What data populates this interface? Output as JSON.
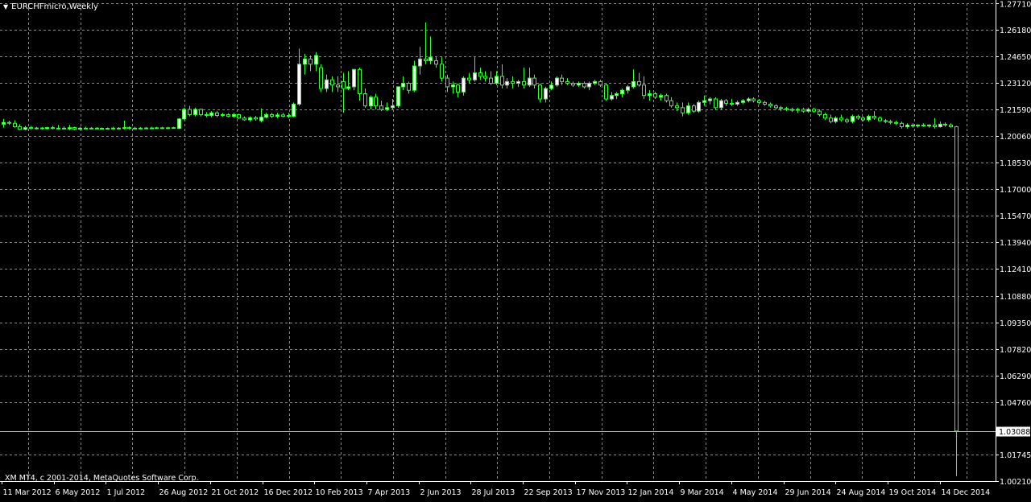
{
  "title": "EURCHFmicro,Weekly",
  "copyright": "XM MT4, c 2001-2014, MetaQuotes Software Corp.",
  "colors": {
    "background": "#000000",
    "bull": "#ffffff",
    "bear": "#000000",
    "wick": "#33ff33",
    "grid": "#8a8a8a",
    "axis_text": "#ffffff"
  },
  "icons": {
    "title_menu": "triangle-down-icon"
  },
  "chart_data": {
    "type": "candlestick",
    "symbol": "EURCHFmicro",
    "timeframe": "Weekly",
    "ylim": [
      1.0021,
      1.2771
    ],
    "grid": true,
    "y_ticks": [
      "1.27710",
      "1.26180",
      "1.24650",
      "1.23120",
      "1.21590",
      "1.20060",
      "1.18530",
      "1.17000",
      "1.15470",
      "1.13940",
      "1.12410",
      "1.10880",
      "1.09350",
      "1.07820",
      "1.06290",
      "1.04760",
      "1.03088",
      "1.01745",
      "1.00210"
    ],
    "current_price": "1.03088",
    "x_tick_labels": [
      "11 Mar 2012",
      "6 May 2012",
      "1 Jul 2012",
      "26 Aug 2012",
      "21 Oct 2012",
      "16 Dec 2012",
      "10 Feb 2013",
      "7 Apr 2013",
      "2 Jun 2013",
      "28 Jul 2013",
      "22 Sep 2013",
      "17 Nov 2013",
      "12 Jan 2014",
      "9 Mar 2014",
      "4 May 2014",
      "29 Jun 2014",
      "24 Aug 2014",
      "19 Oct 2014",
      "14 Dec 2014"
    ],
    "candles": [
      {
        "o": 1.2075,
        "h": 1.2105,
        "l": 1.2055,
        "c": 1.2085
      },
      {
        "o": 1.2085,
        "h": 1.2095,
        "l": 1.207,
        "c": 1.208
      },
      {
        "o": 1.208,
        "h": 1.2098,
        "l": 1.2055,
        "c": 1.206
      },
      {
        "o": 1.206,
        "h": 1.2075,
        "l": 1.204,
        "c": 1.2045
      },
      {
        "o": 1.2045,
        "h": 1.2065,
        "l": 1.204,
        "c": 1.2055
      },
      {
        "o": 1.2055,
        "h": 1.2065,
        "l": 1.2045,
        "c": 1.205
      },
      {
        "o": 1.205,
        "h": 1.206,
        "l": 1.2045,
        "c": 1.2053
      },
      {
        "o": 1.2053,
        "h": 1.2058,
        "l": 1.2045,
        "c": 1.2049
      },
      {
        "o": 1.2049,
        "h": 1.206,
        "l": 1.2045,
        "c": 1.2055
      },
      {
        "o": 1.2055,
        "h": 1.2065,
        "l": 1.2045,
        "c": 1.205
      },
      {
        "o": 1.205,
        "h": 1.207,
        "l": 1.2045,
        "c": 1.2052
      },
      {
        "o": 1.2052,
        "h": 1.2062,
        "l": 1.2045,
        "c": 1.2048
      },
      {
        "o": 1.2048,
        "h": 1.207,
        "l": 1.204,
        "c": 1.2055
      },
      {
        "o": 1.2055,
        "h": 1.206,
        "l": 1.204,
        "c": 1.2046
      },
      {
        "o": 1.2046,
        "h": 1.206,
        "l": 1.2043,
        "c": 1.2052
      },
      {
        "o": 1.2052,
        "h": 1.206,
        "l": 1.2047,
        "c": 1.205
      },
      {
        "o": 1.205,
        "h": 1.2058,
        "l": 1.2046,
        "c": 1.2052
      },
      {
        "o": 1.2052,
        "h": 1.2058,
        "l": 1.2047,
        "c": 1.205
      },
      {
        "o": 1.205,
        "h": 1.2056,
        "l": 1.2046,
        "c": 1.2051
      },
      {
        "o": 1.2051,
        "h": 1.2056,
        "l": 1.2047,
        "c": 1.205
      },
      {
        "o": 1.205,
        "h": 1.206,
        "l": 1.2046,
        "c": 1.2052
      },
      {
        "o": 1.2052,
        "h": 1.2058,
        "l": 1.2047,
        "c": 1.205
      },
      {
        "o": 1.205,
        "h": 1.2095,
        "l": 1.2045,
        "c": 1.2055
      },
      {
        "o": 1.2055,
        "h": 1.2062,
        "l": 1.2045,
        "c": 1.205
      },
      {
        "o": 1.205,
        "h": 1.206,
        "l": 1.2048,
        "c": 1.2052
      },
      {
        "o": 1.2052,
        "h": 1.2058,
        "l": 1.2048,
        "c": 1.205
      },
      {
        "o": 1.205,
        "h": 1.2058,
        "l": 1.2048,
        "c": 1.2053
      },
      {
        "o": 1.2053,
        "h": 1.206,
        "l": 1.2048,
        "c": 1.2051
      },
      {
        "o": 1.2051,
        "h": 1.206,
        "l": 1.2048,
        "c": 1.2054
      },
      {
        "o": 1.2054,
        "h": 1.206,
        "l": 1.2047,
        "c": 1.2052
      },
      {
        "o": 1.2052,
        "h": 1.206,
        "l": 1.2048,
        "c": 1.2054
      },
      {
        "o": 1.2054,
        "h": 1.206,
        "l": 1.205,
        "c": 1.2055
      },
      {
        "o": 1.205,
        "h": 1.211,
        "l": 1.2048,
        "c": 1.2105
      },
      {
        "o": 1.2105,
        "h": 1.217,
        "l": 1.21,
        "c": 1.216
      },
      {
        "o": 1.216,
        "h": 1.218,
        "l": 1.212,
        "c": 1.213
      },
      {
        "o": 1.213,
        "h": 1.217,
        "l": 1.212,
        "c": 1.216
      },
      {
        "o": 1.216,
        "h": 1.2165,
        "l": 1.212,
        "c": 1.213
      },
      {
        "o": 1.213,
        "h": 1.2145,
        "l": 1.2115,
        "c": 1.2125
      },
      {
        "o": 1.2125,
        "h": 1.215,
        "l": 1.2115,
        "c": 1.214
      },
      {
        "o": 1.214,
        "h": 1.215,
        "l": 1.2115,
        "c": 1.2125
      },
      {
        "o": 1.2125,
        "h": 1.214,
        "l": 1.2118,
        "c": 1.213
      },
      {
        "o": 1.213,
        "h": 1.2138,
        "l": 1.2115,
        "c": 1.212
      },
      {
        "o": 1.212,
        "h": 1.214,
        "l": 1.2112,
        "c": 1.213
      },
      {
        "o": 1.213,
        "h": 1.2135,
        "l": 1.2105,
        "c": 1.211
      },
      {
        "o": 1.211,
        "h": 1.212,
        "l": 1.2095,
        "c": 1.21
      },
      {
        "o": 1.21,
        "h": 1.212,
        "l": 1.209,
        "c": 1.2112
      },
      {
        "o": 1.2112,
        "h": 1.2122,
        "l": 1.2095,
        "c": 1.2105
      },
      {
        "o": 1.2095,
        "h": 1.2165,
        "l": 1.2085,
        "c": 1.2115
      },
      {
        "o": 1.2115,
        "h": 1.214,
        "l": 1.2108,
        "c": 1.213
      },
      {
        "o": 1.213,
        "h": 1.214,
        "l": 1.211,
        "c": 1.212
      },
      {
        "o": 1.212,
        "h": 1.214,
        "l": 1.211,
        "c": 1.2128
      },
      {
        "o": 1.2128,
        "h": 1.214,
        "l": 1.2115,
        "c": 1.212
      },
      {
        "o": 1.212,
        "h": 1.214,
        "l": 1.211,
        "c": 1.2125
      },
      {
        "o": 1.212,
        "h": 1.22,
        "l": 1.2115,
        "c": 1.219
      },
      {
        "o": 1.219,
        "h": 1.251,
        "l": 1.218,
        "c": 1.242
      },
      {
        "o": 1.242,
        "h": 1.248,
        "l": 1.236,
        "c": 1.245
      },
      {
        "o": 1.245,
        "h": 1.247,
        "l": 1.238,
        "c": 1.242
      },
      {
        "o": 1.242,
        "h": 1.249,
        "l": 1.238,
        "c": 1.247
      },
      {
        "o": 1.24,
        "h": 1.242,
        "l": 1.226,
        "c": 1.228
      },
      {
        "o": 1.228,
        "h": 1.236,
        "l": 1.226,
        "c": 1.233
      },
      {
        "o": 1.233,
        "h": 1.235,
        "l": 1.226,
        "c": 1.23
      },
      {
        "o": 1.23,
        "h": 1.235,
        "l": 1.226,
        "c": 1.229
      },
      {
        "o": 1.232,
        "h": 1.237,
        "l": 1.214,
        "c": 1.228
      },
      {
        "o": 1.228,
        "h": 1.238,
        "l": 1.227,
        "c": 1.229
      },
      {
        "o": 1.229,
        "h": 1.238,
        "l": 1.227,
        "c": 1.239
      },
      {
        "o": 1.239,
        "h": 1.24,
        "l": 1.221,
        "c": 1.225
      },
      {
        "o": 1.225,
        "h": 1.228,
        "l": 1.217,
        "c": 1.218
      },
      {
        "o": 1.218,
        "h": 1.224,
        "l": 1.216,
        "c": 1.223
      },
      {
        "o": 1.223,
        "h": 1.225,
        "l": 1.216,
        "c": 1.218
      },
      {
        "o": 1.218,
        "h": 1.221,
        "l": 1.215,
        "c": 1.216
      },
      {
        "o": 1.216,
        "h": 1.22,
        "l": 1.215,
        "c": 1.217
      },
      {
        "o": 1.217,
        "h": 1.222,
        "l": 1.216,
        "c": 1.218
      },
      {
        "o": 1.218,
        "h": 1.229,
        "l": 1.217,
        "c": 1.229
      },
      {
        "o": 1.229,
        "h": 1.235,
        "l": 1.227,
        "c": 1.231
      },
      {
        "o": 1.231,
        "h": 1.232,
        "l": 1.225,
        "c": 1.227
      },
      {
        "o": 1.227,
        "h": 1.244,
        "l": 1.226,
        "c": 1.241
      },
      {
        "o": 1.241,
        "h": 1.252,
        "l": 1.236,
        "c": 1.245
      },
      {
        "o": 1.245,
        "h": 1.266,
        "l": 1.242,
        "c": 1.244
      },
      {
        "o": 1.244,
        "h": 1.258,
        "l": 1.242,
        "c": 1.246
      },
      {
        "o": 1.244,
        "h": 1.246,
        "l": 1.24,
        "c": 1.242
      },
      {
        "o": 1.242,
        "h": 1.246,
        "l": 1.232,
        "c": 1.234
      },
      {
        "o": 1.234,
        "h": 1.236,
        "l": 1.226,
        "c": 1.229
      },
      {
        "o": 1.229,
        "h": 1.232,
        "l": 1.225,
        "c": 1.23
      },
      {
        "o": 1.23,
        "h": 1.231,
        "l": 1.223,
        "c": 1.226
      },
      {
        "o": 1.226,
        "h": 1.235,
        "l": 1.224,
        "c": 1.234
      },
      {
        "o": 1.234,
        "h": 1.237,
        "l": 1.231,
        "c": 1.233
      },
      {
        "o": 1.233,
        "h": 1.246,
        "l": 1.232,
        "c": 1.237
      },
      {
        "o": 1.237,
        "h": 1.24,
        "l": 1.233,
        "c": 1.235
      },
      {
        "o": 1.235,
        "h": 1.238,
        "l": 1.232,
        "c": 1.234
      },
      {
        "o": 1.234,
        "h": 1.238,
        "l": 1.23,
        "c": 1.231
      },
      {
        "o": 1.231,
        "h": 1.238,
        "l": 1.23,
        "c": 1.235
      },
      {
        "o": 1.235,
        "h": 1.242,
        "l": 1.228,
        "c": 1.23
      },
      {
        "o": 1.23,
        "h": 1.234,
        "l": 1.228,
        "c": 1.232
      },
      {
        "o": 1.232,
        "h": 1.235,
        "l": 1.228,
        "c": 1.231
      },
      {
        "o": 1.231,
        "h": 1.233,
        "l": 1.229,
        "c": 1.232
      },
      {
        "o": 1.232,
        "h": 1.24,
        "l": 1.228,
        "c": 1.23
      },
      {
        "o": 1.23,
        "h": 1.24,
        "l": 1.229,
        "c": 1.234
      },
      {
        "o": 1.234,
        "h": 1.236,
        "l": 1.228,
        "c": 1.23
      },
      {
        "o": 1.23,
        "h": 1.231,
        "l": 1.22,
        "c": 1.222
      },
      {
        "o": 1.222,
        "h": 1.229,
        "l": 1.22,
        "c": 1.228
      },
      {
        "o": 1.228,
        "h": 1.232,
        "l": 1.227,
        "c": 1.23
      },
      {
        "o": 1.23,
        "h": 1.235,
        "l": 1.229,
        "c": 1.234
      },
      {
        "o": 1.234,
        "h": 1.236,
        "l": 1.23,
        "c": 1.232
      },
      {
        "o": 1.232,
        "h": 1.234,
        "l": 1.23,
        "c": 1.231
      },
      {
        "o": 1.231,
        "h": 1.232,
        "l": 1.229,
        "c": 1.23
      },
      {
        "o": 1.23,
        "h": 1.232,
        "l": 1.229,
        "c": 1.231
      },
      {
        "o": 1.231,
        "h": 1.232,
        "l": 1.228,
        "c": 1.229
      },
      {
        "o": 1.229,
        "h": 1.232,
        "l": 1.227,
        "c": 1.231
      },
      {
        "o": 1.231,
        "h": 1.233,
        "l": 1.23,
        "c": 1.232
      },
      {
        "o": 1.232,
        "h": 1.233,
        "l": 1.229,
        "c": 1.23
      },
      {
        "o": 1.23,
        "h": 1.231,
        "l": 1.221,
        "c": 1.222
      },
      {
        "o": 1.222,
        "h": 1.226,
        "l": 1.221,
        "c": 1.224
      },
      {
        "o": 1.224,
        "h": 1.226,
        "l": 1.222,
        "c": 1.225
      },
      {
        "o": 1.225,
        "h": 1.228,
        "l": 1.223,
        "c": 1.227
      },
      {
        "o": 1.227,
        "h": 1.23,
        "l": 1.225,
        "c": 1.229
      },
      {
        "o": 1.229,
        "h": 1.239,
        "l": 1.228,
        "c": 1.232
      },
      {
        "o": 1.232,
        "h": 1.237,
        "l": 1.229,
        "c": 1.23
      },
      {
        "o": 1.23,
        "h": 1.235,
        "l": 1.222,
        "c": 1.224
      },
      {
        "o": 1.224,
        "h": 1.227,
        "l": 1.221,
        "c": 1.225
      },
      {
        "o": 1.225,
        "h": 1.226,
        "l": 1.222,
        "c": 1.223
      },
      {
        "o": 1.223,
        "h": 1.225,
        "l": 1.221,
        "c": 1.224
      },
      {
        "o": 1.224,
        "h": 1.225,
        "l": 1.22,
        "c": 1.221
      },
      {
        "o": 1.221,
        "h": 1.223,
        "l": 1.217,
        "c": 1.218
      },
      {
        "o": 1.218,
        "h": 1.22,
        "l": 1.215,
        "c": 1.217
      },
      {
        "o": 1.217,
        "h": 1.22,
        "l": 1.212,
        "c": 1.214
      },
      {
        "o": 1.214,
        "h": 1.22,
        "l": 1.213,
        "c": 1.218
      },
      {
        "o": 1.218,
        "h": 1.219,
        "l": 1.214,
        "c": 1.215
      },
      {
        "o": 1.215,
        "h": 1.221,
        "l": 1.214,
        "c": 1.22
      },
      {
        "o": 1.22,
        "h": 1.224,
        "l": 1.218,
        "c": 1.221
      },
      {
        "o": 1.221,
        "h": 1.223,
        "l": 1.219,
        "c": 1.222
      },
      {
        "o": 1.222,
        "h": 1.223,
        "l": 1.216,
        "c": 1.217
      },
      {
        "o": 1.217,
        "h": 1.222,
        "l": 1.216,
        "c": 1.221
      },
      {
        "o": 1.221,
        "h": 1.222,
        "l": 1.218,
        "c": 1.2195
      },
      {
        "o": 1.2195,
        "h": 1.222,
        "l": 1.218,
        "c": 1.219
      },
      {
        "o": 1.219,
        "h": 1.221,
        "l": 1.218,
        "c": 1.22
      },
      {
        "o": 1.22,
        "h": 1.222,
        "l": 1.219,
        "c": 1.221
      },
      {
        "o": 1.221,
        "h": 1.223,
        "l": 1.22,
        "c": 1.222
      },
      {
        "o": 1.222,
        "h": 1.223,
        "l": 1.22,
        "c": 1.221
      },
      {
        "o": 1.221,
        "h": 1.222,
        "l": 1.219,
        "c": 1.22
      },
      {
        "o": 1.22,
        "h": 1.221,
        "l": 1.218,
        "c": 1.219
      },
      {
        "o": 1.219,
        "h": 1.22,
        "l": 1.217,
        "c": 1.218
      },
      {
        "o": 1.218,
        "h": 1.219,
        "l": 1.216,
        "c": 1.217
      },
      {
        "o": 1.217,
        "h": 1.218,
        "l": 1.215,
        "c": 1.2165
      },
      {
        "o": 1.2165,
        "h": 1.2175,
        "l": 1.215,
        "c": 1.216
      },
      {
        "o": 1.216,
        "h": 1.217,
        "l": 1.2145,
        "c": 1.2155
      },
      {
        "o": 1.2155,
        "h": 1.217,
        "l": 1.214,
        "c": 1.216
      },
      {
        "o": 1.216,
        "h": 1.217,
        "l": 1.214,
        "c": 1.215
      },
      {
        "o": 1.215,
        "h": 1.217,
        "l": 1.214,
        "c": 1.216
      },
      {
        "o": 1.216,
        "h": 1.217,
        "l": 1.214,
        "c": 1.215
      },
      {
        "o": 1.215,
        "h": 1.216,
        "l": 1.212,
        "c": 1.213
      },
      {
        "o": 1.213,
        "h": 1.214,
        "l": 1.21,
        "c": 1.211
      },
      {
        "o": 1.211,
        "h": 1.213,
        "l": 1.208,
        "c": 1.209
      },
      {
        "o": 1.209,
        "h": 1.212,
        "l": 1.208,
        "c": 1.211
      },
      {
        "o": 1.211,
        "h": 1.213,
        "l": 1.209,
        "c": 1.21
      },
      {
        "o": 1.21,
        "h": 1.211,
        "l": 1.208,
        "c": 1.209
      },
      {
        "o": 1.209,
        "h": 1.213,
        "l": 1.208,
        "c": 1.212
      },
      {
        "o": 1.212,
        "h": 1.213,
        "l": 1.21,
        "c": 1.211
      },
      {
        "o": 1.211,
        "h": 1.212,
        "l": 1.209,
        "c": 1.21
      },
      {
        "o": 1.21,
        "h": 1.213,
        "l": 1.209,
        "c": 1.212
      },
      {
        "o": 1.212,
        "h": 1.215,
        "l": 1.21,
        "c": 1.211
      },
      {
        "o": 1.211,
        "h": 1.212,
        "l": 1.209,
        "c": 1.2095
      },
      {
        "o": 1.2095,
        "h": 1.2105,
        "l": 1.208,
        "c": 1.209
      },
      {
        "o": 1.209,
        "h": 1.21,
        "l": 1.2075,
        "c": 1.2085
      },
      {
        "o": 1.2085,
        "h": 1.2095,
        "l": 1.207,
        "c": 1.208
      },
      {
        "o": 1.208,
        "h": 1.209,
        "l": 1.205,
        "c": 1.206
      },
      {
        "o": 1.206,
        "h": 1.208,
        "l": 1.205,
        "c": 1.207
      },
      {
        "o": 1.207,
        "h": 1.208,
        "l": 1.2055,
        "c": 1.2065
      },
      {
        "o": 1.2065,
        "h": 1.2075,
        "l": 1.2055,
        "c": 1.207
      },
      {
        "o": 1.207,
        "h": 1.208,
        "l": 1.206,
        "c": 1.2065
      },
      {
        "o": 1.2065,
        "h": 1.2075,
        "l": 1.2055,
        "c": 1.207
      },
      {
        "o": 1.207,
        "h": 1.211,
        "l": 1.205,
        "c": 1.206
      },
      {
        "o": 1.206,
        "h": 1.209,
        "l": 1.2055,
        "c": 1.2075
      },
      {
        "o": 1.2075,
        "h": 1.2085,
        "l": 1.206,
        "c": 1.207
      },
      {
        "o": 1.207,
        "h": 1.208,
        "l": 1.2055,
        "c": 1.206
      },
      {
        "o": 1.206,
        "h": 1.2065,
        "l": 1.005,
        "c": 1.0309
      }
    ]
  }
}
